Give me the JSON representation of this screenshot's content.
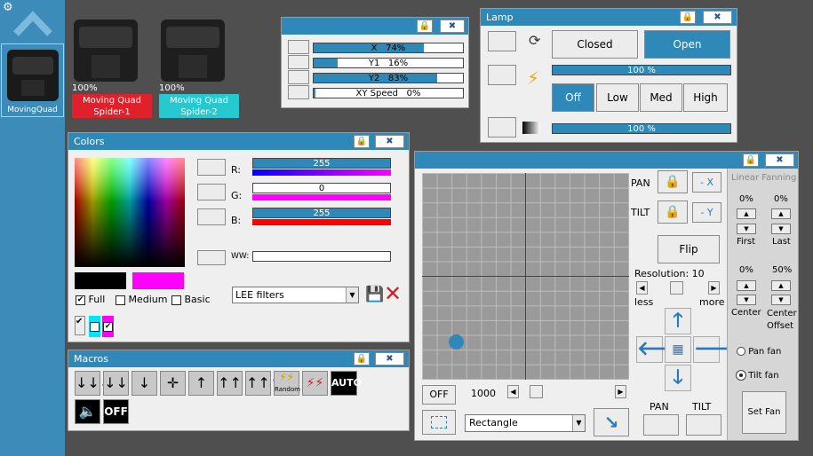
{
  "sidebar": {
    "active_fixture": "MovingQuad"
  },
  "fixtures": [
    {
      "percent": "100%",
      "name": "Moving Quad Spider-1",
      "color": "#e0202a"
    },
    {
      "percent": "100%",
      "name": "Moving Quad Spider-2",
      "color": "#26c9d0"
    }
  ],
  "position_panel": {
    "sliders": [
      {
        "label": "X",
        "value": "74%",
        "fill": 0.74
      },
      {
        "label": "Y1",
        "value": "16%",
        "fill": 0.16
      },
      {
        "label": "Y2",
        "value": "83%",
        "fill": 0.83
      },
      {
        "label": "XY Speed",
        "value": "0%",
        "fill": 0.0
      }
    ]
  },
  "lamp_panel": {
    "title": "Lamp",
    "closed_label": "Closed",
    "open_label": "Open",
    "strobe_value": "100 %",
    "power_options": [
      "Off",
      "Low",
      "Med",
      "High"
    ],
    "dimmer_value": "100 %"
  },
  "colors_panel": {
    "title": "Colors",
    "r_label": "R:",
    "r_value": "255",
    "g_label": "G:",
    "g_value": "0",
    "b_label": "B:",
    "b_value": "255",
    "ww_label": "WW:",
    "full_label": "Full",
    "medium_label": "Medium",
    "basic_label": "Basic",
    "filter_select": "LEE filters",
    "preview_color": "#ff00ff"
  },
  "macros_panel": {
    "title": "Macros",
    "random_label": "Random",
    "auto_label": "AUTO",
    "off_label": "OFF"
  },
  "pantilt_panel": {
    "pan_label": "PAN",
    "tilt_label": "TILT",
    "neg_x_label": "- X",
    "neg_y_label": "- Y",
    "flip_label": "Flip",
    "resolution_label": "Resolution: 10",
    "less_label": "less",
    "more_label": "more",
    "off_label": "OFF",
    "speed_value": "1000",
    "shape_select": "Rectangle",
    "pan_bottom_label": "PAN",
    "tilt_bottom_label": "TILT"
  },
  "fanning_panel": {
    "title": "Linear Fanning",
    "first_value": "0%",
    "first_label": "First",
    "last_value": "0%",
    "last_label": "Last",
    "center_value": "0%",
    "center_label": "Center",
    "offset_value": "50%",
    "offset_label": "Center Offset",
    "pan_fan_label": "Pan fan",
    "tilt_fan_label": "Tilt fan",
    "set_fan_label": "Set Fan"
  }
}
